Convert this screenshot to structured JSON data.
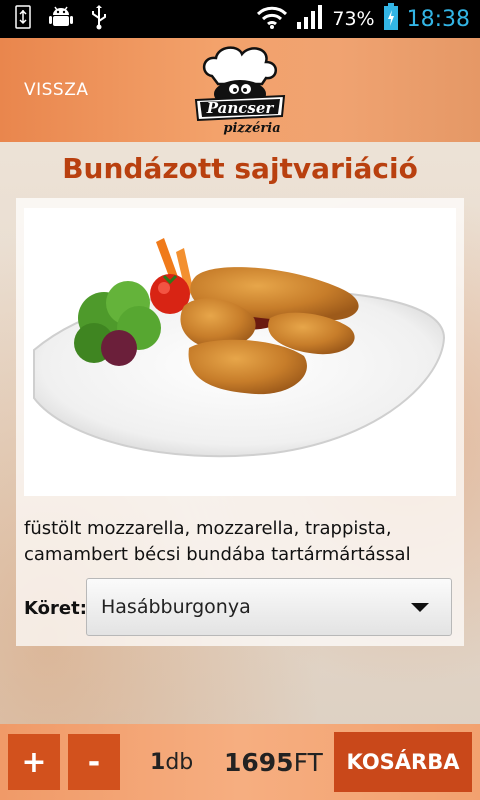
{
  "status_bar": {
    "battery_percent": "73%",
    "time": "18:38",
    "left_icons": [
      "usb-debug-icon",
      "android-icon",
      "usb-icon"
    ],
    "right_icons": [
      "wifi-icon",
      "signal-icon",
      "battery-charging-icon"
    ]
  },
  "header": {
    "back_label": "VISSZA",
    "logo": {
      "brand": "Pancser",
      "subtitle": "pizzéria"
    }
  },
  "product": {
    "title": "Bundázott sajtvariáció",
    "description": "füstölt mozzarella, mozzarella, trappista, camambert bécsi bundába tartármártással",
    "side_label": "Köret:",
    "side_selected": "Hasábburgonya"
  },
  "order": {
    "plus_label": "+",
    "minus_label": "-",
    "quantity": "1",
    "quantity_unit": "db",
    "price": "1695",
    "currency": "FT",
    "cart_label": "KOSÁRBA"
  },
  "colors": {
    "accent_title": "#b9400f",
    "button_bg": "#d2511d",
    "header_bg": "#f3a26b",
    "time_color": "#33b5e5"
  }
}
